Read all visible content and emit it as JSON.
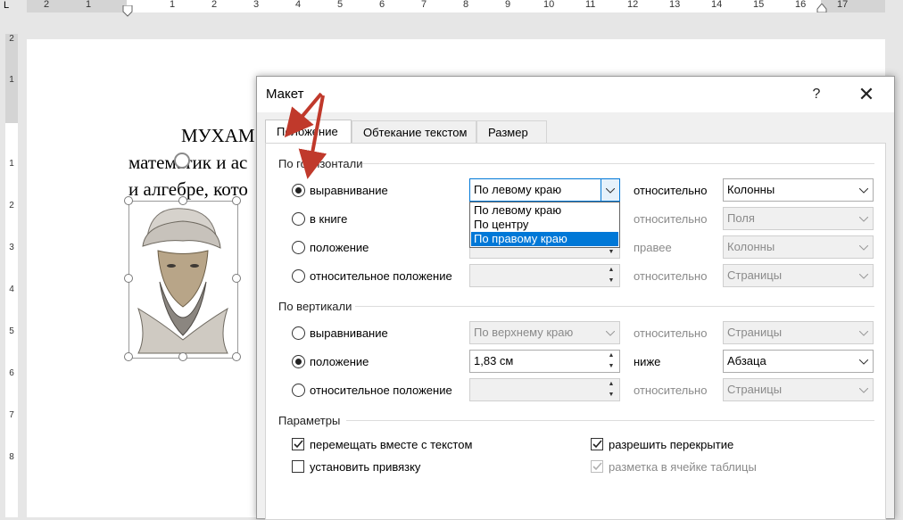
{
  "ruler": {
    "corner": "L",
    "h_labels": [
      "2",
      "1",
      "1",
      "2",
      "3",
      "4",
      "5",
      "6",
      "7",
      "8",
      "9",
      "10",
      "11",
      "12",
      "13",
      "14",
      "15",
      "16",
      "17"
    ],
    "v_labels": [
      "2",
      "1",
      "1",
      "2",
      "3",
      "4",
      "5",
      "6",
      "7",
      "8"
    ]
  },
  "document": {
    "line1": "МУХАМ",
    "line2": "математик и ас",
    "line3": "и алгебре, кото"
  },
  "dialog": {
    "title": "Макет",
    "help": "?",
    "close": "✕",
    "tabs": [
      "Положение",
      "Обтекание текстом",
      "Размер"
    ],
    "horizontal": {
      "section": "По горизонтали",
      "align_label": "выравнивание",
      "align_value": "По левому краю",
      "align_rel_label": "относительно",
      "align_rel_value": "Колонны",
      "book_label": "в книге",
      "book_rel_label": "относительно",
      "book_rel_value": "Поля",
      "pos_label": "положение",
      "pos_rel_label": "правее",
      "pos_rel_value": "Колонны",
      "relpos_label": "относительное положение",
      "relpos_rel_label": "относительно",
      "relpos_rel_value": "Страницы",
      "dropdown": [
        "По левому краю",
        "По центру",
        "По правому краю"
      ]
    },
    "vertical": {
      "section": "По вертикали",
      "align_label": "выравнивание",
      "align_value": "По верхнему краю",
      "align_rel_label": "относительно",
      "align_rel_value": "Страницы",
      "pos_label": "положение",
      "pos_value": "1,83 см",
      "pos_rel_label": "ниже",
      "pos_rel_value": "Абзаца",
      "relpos_label": "относительное положение",
      "relpos_rel_label": "относительно",
      "relpos_rel_value": "Страницы"
    },
    "params": {
      "section": "Параметры",
      "move_with_text": "перемещать вместе с текстом",
      "lock_anchor": "установить привязку",
      "allow_overlap": "разрешить перекрытие",
      "layout_in_cell": "разметка в ячейке таблицы"
    },
    "colors": {
      "accent": "#0078d7",
      "annotation": "#c0392b"
    }
  }
}
